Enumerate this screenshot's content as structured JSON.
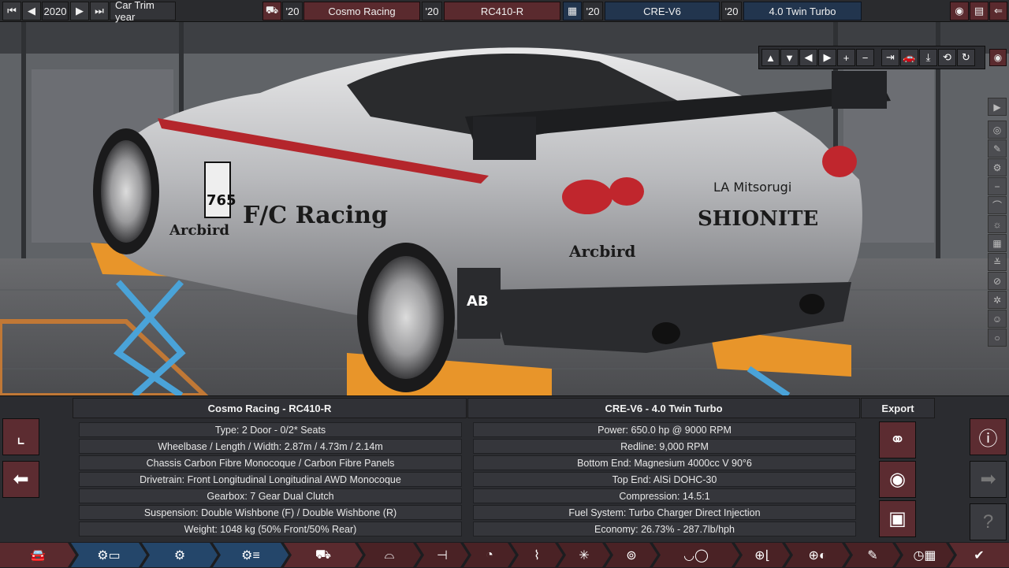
{
  "topbar": {
    "year": "2020",
    "trim_label": "Car Trim year",
    "body_year": "'20",
    "family_name": "Cosmo Racing",
    "model_year": "'20",
    "model_name": "RC410-R",
    "engine_year": "'20",
    "engine_family": "CRE-V6",
    "variant_year": "'20",
    "variant_name": "4.0 Twin Turbo"
  },
  "icons": {
    "first_year": "double-left-arrow-icon",
    "prev_year": "left-arrow-icon",
    "next_year": "right-arrow-icon",
    "last_year": "double-right-arrow-icon",
    "car_body": "car-icon",
    "engine": "engine-block-icon",
    "screenshot": "camera-icon",
    "calculator": "calculator-icon",
    "back": "back-arrow-icon"
  },
  "camera_tools": [
    "▲",
    "▼",
    "◀",
    "▶",
    "+",
    "−",
    "⇥",
    "🚗",
    "⤓",
    "⟲",
    "↻"
  ],
  "car_panel": {
    "title": "Cosmo Racing - RC410-R",
    "rows": [
      "Type: 2 Door - 0/2* Seats",
      "Wheelbase / Length / Width: 2.87m / 4.73m / 2.14m",
      "Chassis Carbon Fibre Monocoque / Carbon Fibre Panels",
      "Drivetrain: Front Longitudinal Longitudinal AWD Monocoque",
      "Gearbox: 7 Gear Dual Clutch",
      "Suspension: Double Wishbone (F) / Double Wishbone (R)",
      "Weight: 1048 kg (50% Front/50% Rear)"
    ]
  },
  "engine_panel": {
    "title": "CRE-V6 - 4.0 Twin Turbo",
    "rows": [
      "Power: 650.0 hp @ 9000 RPM",
      "Redline:  9,000 RPM",
      "Bottom End: Magnesium 4000cc V 90°6",
      "Top End: AlSi DOHC-30",
      "Compression: 14.5:1",
      "Fuel System: Turbo Charger Direct Injection",
      "Economy: 26.73% - 287.7lb/hph"
    ]
  },
  "export": {
    "title": "Export"
  },
  "colors": {
    "accent_red": "#5a2a2e",
    "accent_blue": "#24466a",
    "panel": "#2b2c30"
  }
}
